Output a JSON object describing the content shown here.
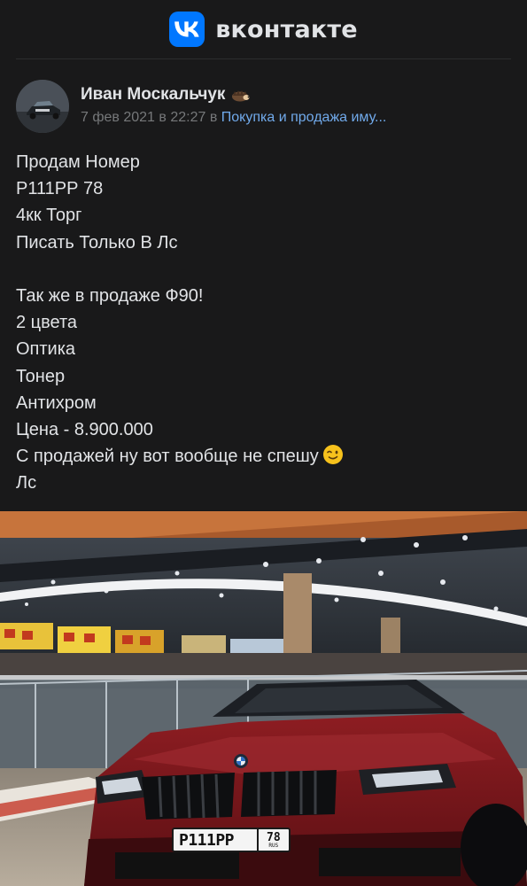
{
  "header": {
    "logo_text": "vk",
    "brand_name": "вконтакте",
    "brand_color": "#0077ff"
  },
  "post": {
    "author": "Иван Москальчук",
    "author_badge_icon": "hedgehog-icon",
    "date": "7 фев 2021 в 22:27",
    "in_word": "в",
    "group": "Покупка и продажа иму...",
    "lines": [
      "Продам Номер",
      "Р111РР 78",
      "4кк Торг",
      "Писать Только В Лс",
      "",
      "Так же в продаже Ф90!",
      "2 цвета",
      "Оптика",
      "Тонер",
      "Антихром",
      "Цена - 8.900.000",
      "С продажей ну вот вообще не спешу",
      "Лс"
    ],
    "wink_emoji": "winking-face-icon"
  },
  "photo": {
    "description_icon": "car-photo",
    "plate_main": "Р111РР",
    "plate_region": "78",
    "plate_country": "RUS"
  }
}
